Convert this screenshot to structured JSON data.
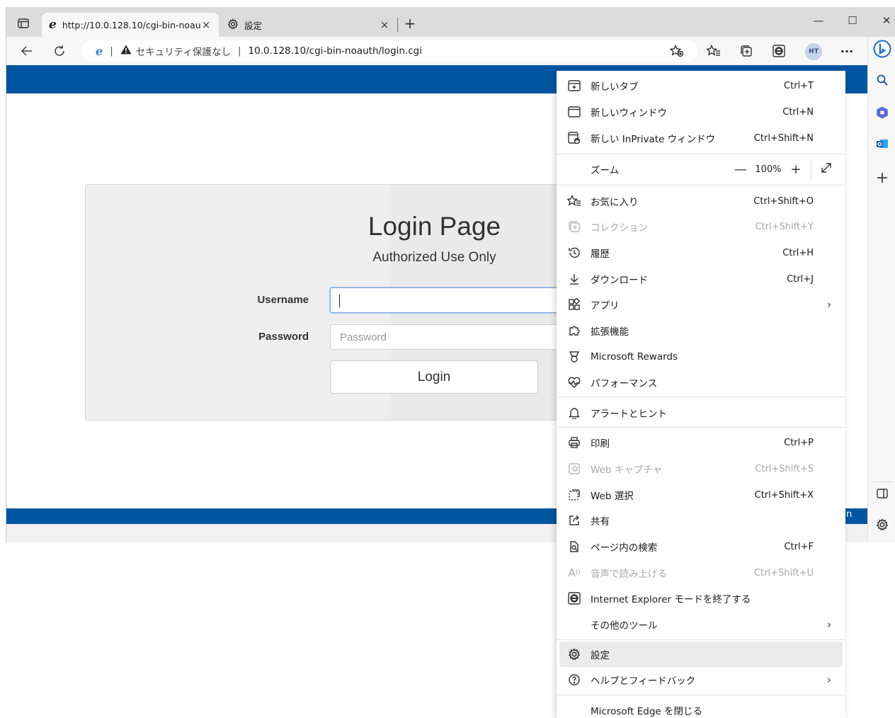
{
  "tabs": [
    {
      "title": "http://10.0.128.10/cgi-bin-noauth",
      "close": "×",
      "icon": "ie-icon"
    },
    {
      "title": "設定",
      "close": "×",
      "icon": "gear-icon"
    }
  ],
  "window_controls": {
    "minimize": "—",
    "maximize": "☐",
    "close": "✕"
  },
  "new_tab_symbol": "+",
  "address": {
    "security_text": "セキュリティ保護なし",
    "divider": "|",
    "url": "10.0.128.10/cgi-bin-noauth/login.cgi"
  },
  "profile": {
    "initials": "HT"
  },
  "toolbar_more": "···",
  "login": {
    "title": "Login Page",
    "subtitle": "Authorized Use Only",
    "username_label": "Username",
    "username_value": "",
    "password_label": "Password",
    "password_placeholder": "Password",
    "button_label": "Login"
  },
  "footer_fragment": "n",
  "menu": {
    "new_tab": {
      "label": "新しいタブ",
      "shortcut": "Ctrl+T"
    },
    "new_window": {
      "label": "新しいウィンドウ",
      "shortcut": "Ctrl+N"
    },
    "new_inprivate": {
      "label": "新しい InPrivate ウィンドウ",
      "shortcut": "Ctrl+Shift+N"
    },
    "zoom": {
      "label": "ズーム",
      "minus": "—",
      "value": "100%",
      "plus": "+"
    },
    "favorites": {
      "label": "お気に入り",
      "shortcut": "Ctrl+Shift+O"
    },
    "collections": {
      "label": "コレクション",
      "shortcut": "Ctrl+Shift+Y"
    },
    "history": {
      "label": "履歴",
      "shortcut": "Ctrl+H"
    },
    "downloads": {
      "label": "ダウンロード",
      "shortcut": "Ctrl+J"
    },
    "apps": {
      "label": "アプリ",
      "chevron": "›"
    },
    "extensions": {
      "label": "拡張機能"
    },
    "rewards": {
      "label": "Microsoft Rewards"
    },
    "performance": {
      "label": "パフォーマンス"
    },
    "alerts": {
      "label": "アラートとヒント"
    },
    "print": {
      "label": "印刷",
      "shortcut": "Ctrl+P"
    },
    "web_capture": {
      "label": "Web キャプチャ",
      "shortcut": "Ctrl+Shift+S"
    },
    "web_select": {
      "label": "Web 選択",
      "shortcut": "Ctrl+Shift+X"
    },
    "share": {
      "label": "共有"
    },
    "find": {
      "label": "ページ内の検索",
      "shortcut": "Ctrl+F"
    },
    "read_aloud": {
      "label": "音声で読み上げる",
      "shortcut": "Ctrl+Shift+U"
    },
    "ie_mode": {
      "label": "Internet Explorer モードを終了する"
    },
    "more_tools": {
      "label": "その他のツール",
      "chevron": "›"
    },
    "settings": {
      "label": "設定"
    },
    "help": {
      "label": "ヘルプとフィードバック",
      "chevron": "›"
    },
    "close_edge": {
      "label": "Microsoft Edge を閉じる"
    }
  },
  "colors": {
    "page_header": "#0055a0",
    "menu_hover": "#ebebeb",
    "bing_blue": "#1b6fd1"
  }
}
